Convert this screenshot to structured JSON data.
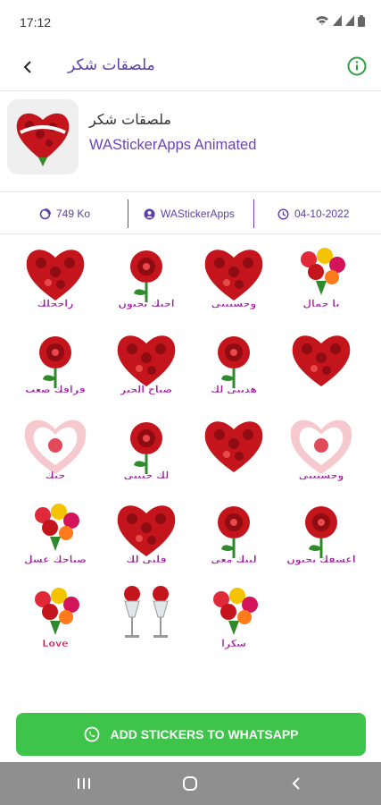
{
  "status": {
    "time": "17:12"
  },
  "app_bar": {
    "title": "ملصقات شكر"
  },
  "pack": {
    "name": "ملصقات شكر",
    "publisher": "WAStickerApps Animated",
    "size": "749 Ko",
    "author": "WAStickerApps",
    "date": "04-10-2022"
  },
  "stickers": [
    {
      "caption": "راحجلك",
      "kind": "heart-roses"
    },
    {
      "caption": "احبك بجنون",
      "kind": "rose-text"
    },
    {
      "caption": "وحشتيني",
      "kind": "heart-roses"
    },
    {
      "caption": "يا جمال",
      "kind": "bouquet"
    },
    {
      "caption": "فراقك صعب",
      "kind": "rose-text"
    },
    {
      "caption": "صباح الخير",
      "kind": "heart-roses"
    },
    {
      "caption": "هديتي لك",
      "kind": "rose-text"
    },
    {
      "caption": "",
      "kind": "heart-roses"
    },
    {
      "caption": "حبك",
      "kind": "heart-pink"
    },
    {
      "caption": "لك حبيبي",
      "kind": "rose-text"
    },
    {
      "caption": "",
      "kind": "heart-roses"
    },
    {
      "caption": "وحشتيني",
      "kind": "heart-pink"
    },
    {
      "caption": "صباحك عسل",
      "kind": "bouquet"
    },
    {
      "caption": "قلبي لك",
      "kind": "heart-roses"
    },
    {
      "caption": "ليتك معي",
      "kind": "rose-text"
    },
    {
      "caption": "اعشقك بجنون",
      "kind": "rose-text"
    },
    {
      "caption": "Love",
      "kind": "bouquet"
    },
    {
      "caption": "",
      "kind": "glasses"
    },
    {
      "caption": "شكرا",
      "kind": "bouquet"
    }
  ],
  "cta": {
    "label": "ADD STICKERS TO WHATSAPP"
  },
  "colors": {
    "accent": "#5b3fa6",
    "cta": "#3ec44b",
    "rose": "#c4141c"
  }
}
